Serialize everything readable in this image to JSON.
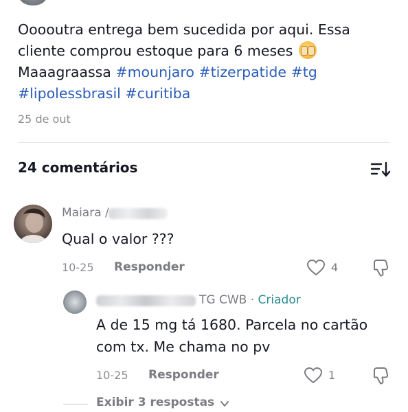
{
  "post": {
    "text_line1": "Ooooutra entrega bem sucedida por aqui. Essa",
    "text_line2": "cliente comprou estoque para 6 meses",
    "emoji_icon": "shocked-face-emoji",
    "text_line3_prefix": "Maaagraassa",
    "hashtags": [
      "#mounjaro",
      "#tizerpatide",
      "#tg",
      "#lipolessbrasil",
      "#curitiba"
    ],
    "date": "25 de out"
  },
  "comments_header": {
    "title": "24 comentários",
    "sort_icon": "sort-icon"
  },
  "comment1": {
    "author_visible": "Maiara",
    "author_partial": "/",
    "text": "Qual o valor ???",
    "date": "10-25",
    "reply_label": "Responder",
    "likes": "4"
  },
  "reply1": {
    "author_visible": "TG CWB",
    "separator": " · ",
    "badge": "Criador",
    "text": "A de 15 mg tá 1680. Parcela no cartão com tx. Me chama no pv",
    "date": "10-25",
    "reply_label": "Responder",
    "likes": "1"
  },
  "view_more": {
    "label": "Exibir 3 respostas"
  },
  "colors": {
    "hashtag": "#2b5db9",
    "creator_badge": "#2b8a8f",
    "muted": "#7b7c82"
  }
}
